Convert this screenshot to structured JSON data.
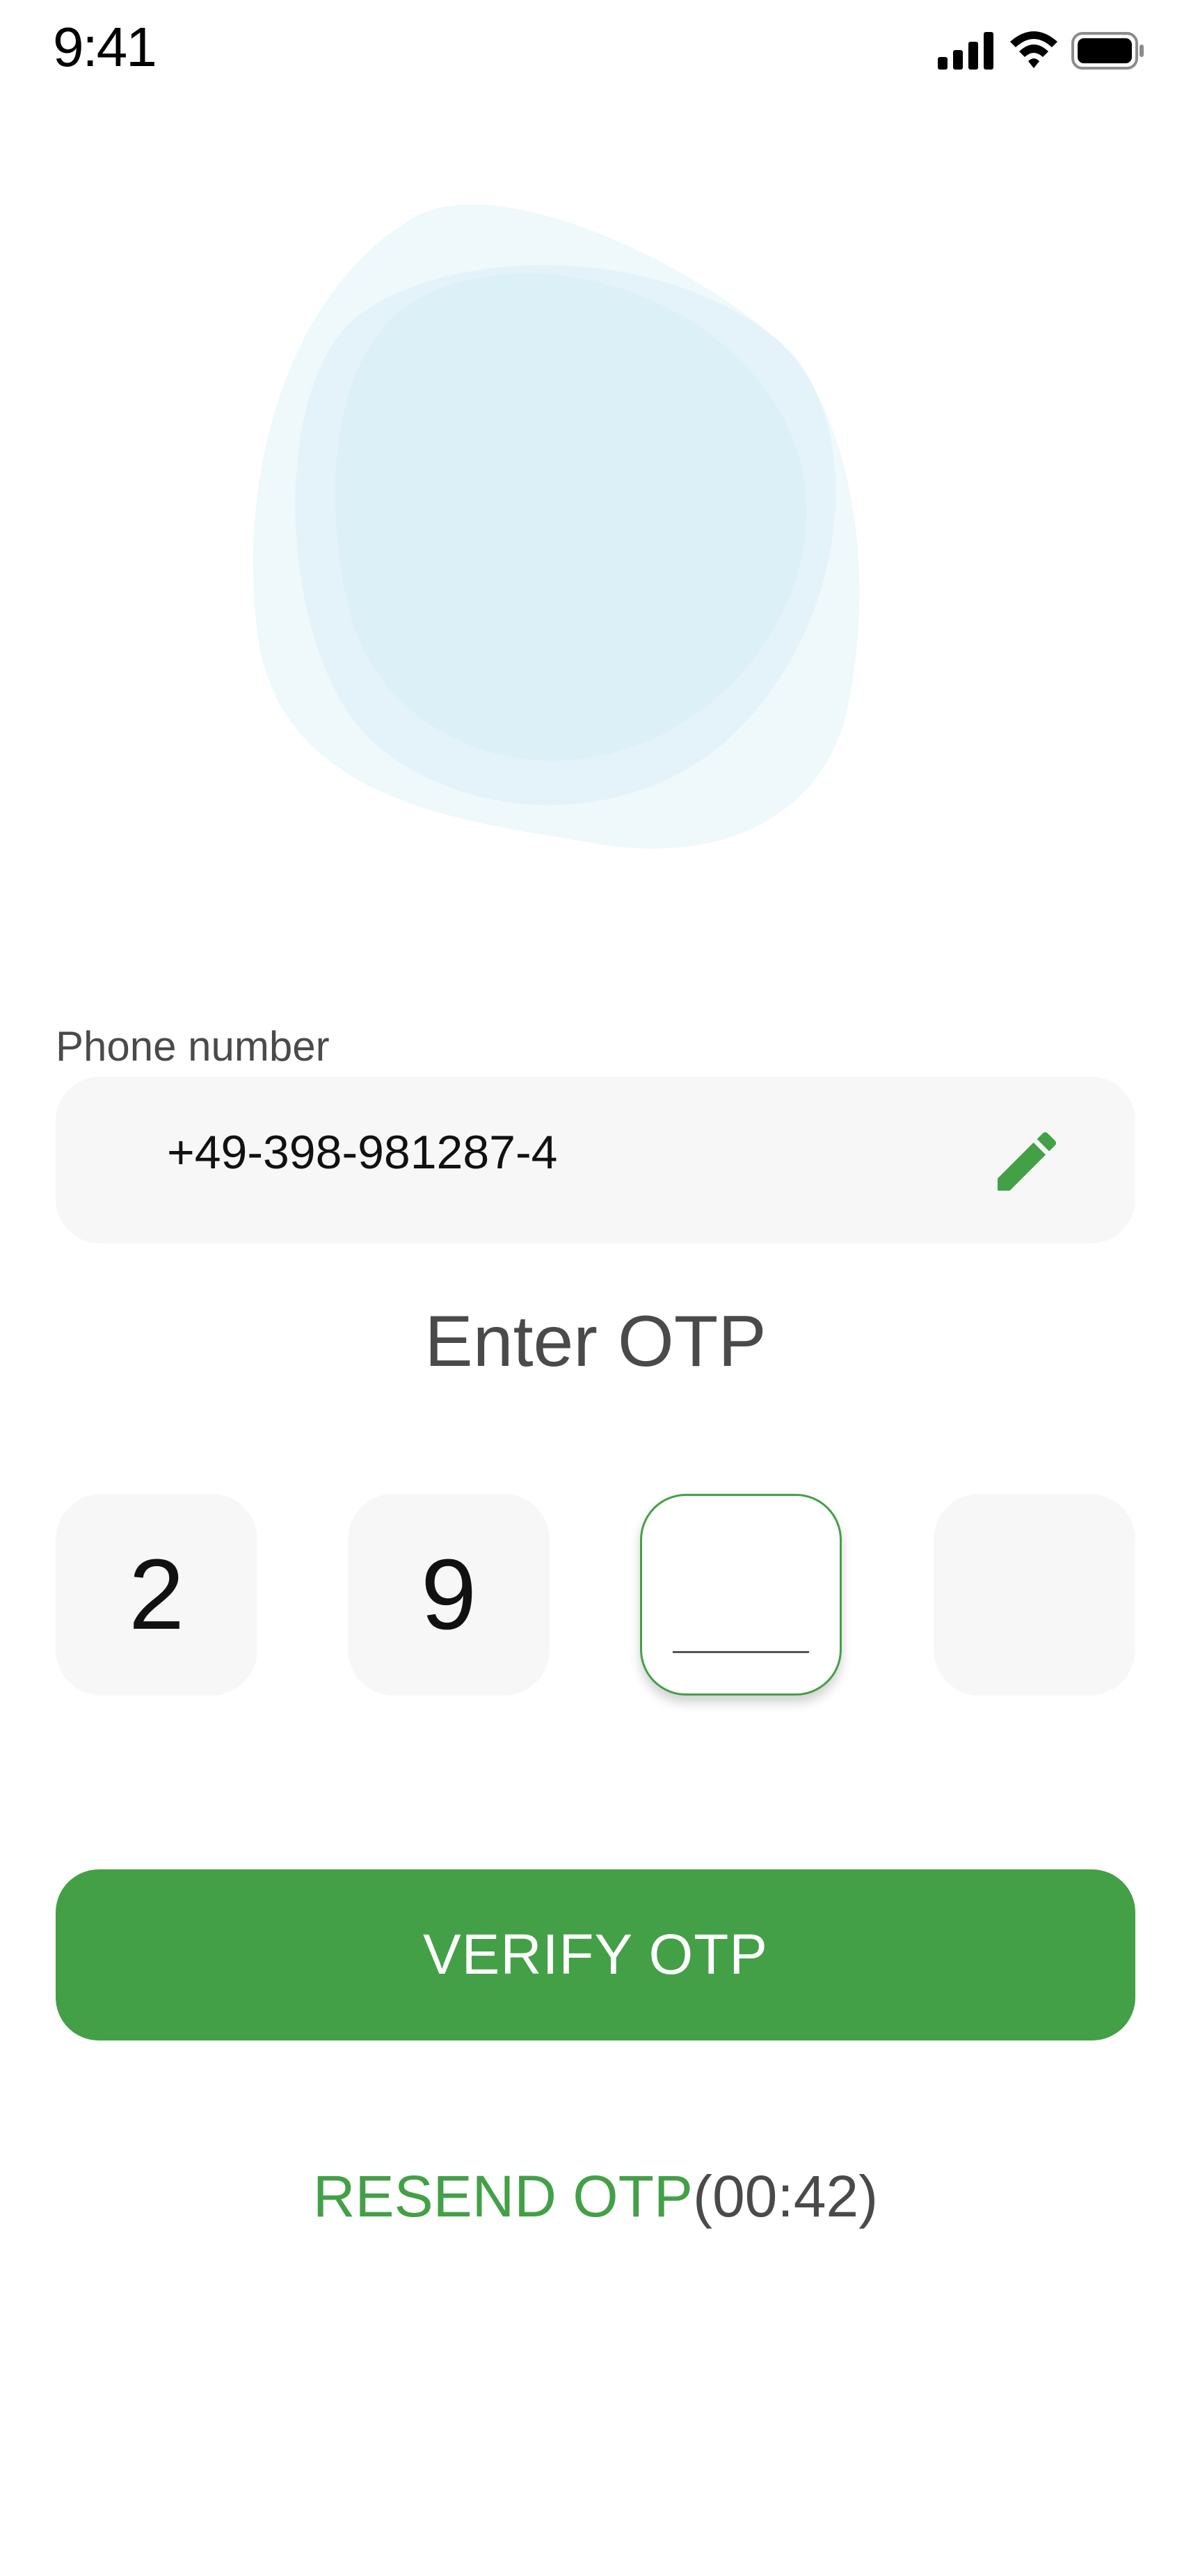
{
  "status_bar": {
    "time": "9:41",
    "icons": [
      "cellular-signal-icon",
      "wifi-icon",
      "battery-icon"
    ]
  },
  "illustration": {
    "name": "blob-illustration",
    "color": "#dbeff7"
  },
  "phone": {
    "label": "Phone number",
    "value": "+49-398-981287-4",
    "edit_icon": "pencil-icon"
  },
  "otp": {
    "title": "Enter OTP",
    "digits": [
      "2",
      "9",
      "",
      ""
    ],
    "active_index": 2
  },
  "verify_button": {
    "label": "VERIFY OTP"
  },
  "resend": {
    "label": "RESEND OTP",
    "timer": "(00:42)"
  },
  "colors": {
    "accent": "#43a047",
    "field_bg": "#f7f7f7",
    "text_muted": "#4a4a4a"
  }
}
